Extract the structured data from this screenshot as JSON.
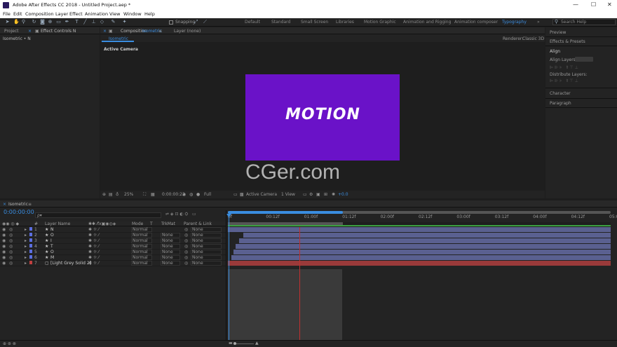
{
  "window": {
    "title": "Adobe After Effects CC 2018 - Untitled Project.aep *",
    "minimize": "—",
    "maximize": "☐",
    "close": "✕"
  },
  "menu": [
    "File",
    "Edit",
    "Composition",
    "Layer",
    "Effect",
    "Animation",
    "View",
    "Window",
    "Help"
  ],
  "toolbar": {
    "snapping": "Snapping",
    "search": "Search Help"
  },
  "workspaces": [
    "Default",
    "Standard",
    "Small Screen",
    "Libraries",
    "Motion Graphic",
    "Animation and Rigging",
    "Animation composer",
    "Typography"
  ],
  "active_workspace": "Typography",
  "project_panel": {
    "tab": "Project",
    "effect_tab": "Effect Controls N",
    "item": "Isometric • N"
  },
  "composition_panel": {
    "tab": "Composition",
    "comp_name": "Isometric",
    "layer_tab": "Layer (none)",
    "subtab": "Isometric",
    "renderer_label": "Renderer:",
    "renderer": "Classic 3D",
    "camera_label": "Active Camera",
    "canvas_text": "MOTION",
    "canvas_color": "#6a12c8"
  },
  "viewer_bar": {
    "zoom": "25%",
    "time": "0:00:00:22",
    "resolution": "Full",
    "camera": "Active Camera",
    "views": "1 View",
    "exposure": "+0.0"
  },
  "watermark": "CGer.com",
  "right_panel": {
    "preview": "Preview",
    "effects": "Effects & Presets",
    "align": "Align",
    "align_to": "Align Layers to:",
    "distribute": "Distribute Layers:",
    "character": "Character",
    "paragraph": "Paragraph"
  },
  "timeline": {
    "tab": "Isometric",
    "timecode": "0:00:00:00",
    "search_placeholder": "ρ▾",
    "headers": {
      "num": "#",
      "name": "Layer Name",
      "mode": "Mode",
      "t": "T",
      "trkmat": "TrkMat",
      "parent": "Parent & Link"
    },
    "ruler": [
      "0f",
      "00:12f",
      "01:00f",
      "01:12f",
      "02:00f",
      "02:12f",
      "03:00f",
      "03:12f",
      "04:00f",
      "04:12f",
      "05:0"
    ],
    "layers": [
      {
        "num": "1",
        "name": "N",
        "color": "#5b6ee0",
        "mode": "Normal",
        "trkmat": "",
        "parent": "None",
        "start": 0.0
      },
      {
        "num": "2",
        "name": "O",
        "color": "#5b6ee0",
        "mode": "Normal",
        "trkmat": "None",
        "parent": "None",
        "start": 0.04
      },
      {
        "num": "3",
        "name": "I",
        "color": "#5b6ee0",
        "mode": "Normal",
        "trkmat": "None",
        "parent": "None",
        "start": 0.03
      },
      {
        "num": "4",
        "name": "T",
        "color": "#5b6ee0",
        "mode": "Normal",
        "trkmat": "None",
        "parent": "None",
        "start": 0.02
      },
      {
        "num": "5",
        "name": "O",
        "color": "#5b6ee0",
        "mode": "Normal",
        "trkmat": "None",
        "parent": "None",
        "start": 0.015
      },
      {
        "num": "6",
        "name": "M",
        "color": "#5b6ee0",
        "mode": "Normal",
        "trkmat": "None",
        "parent": "None",
        "start": 0.01
      },
      {
        "num": "7",
        "name": "[Light Grey Solid 2]",
        "color": "#c04040",
        "mode": "Normal",
        "trkmat": "None",
        "parent": "None",
        "start": 0.0
      }
    ]
  }
}
